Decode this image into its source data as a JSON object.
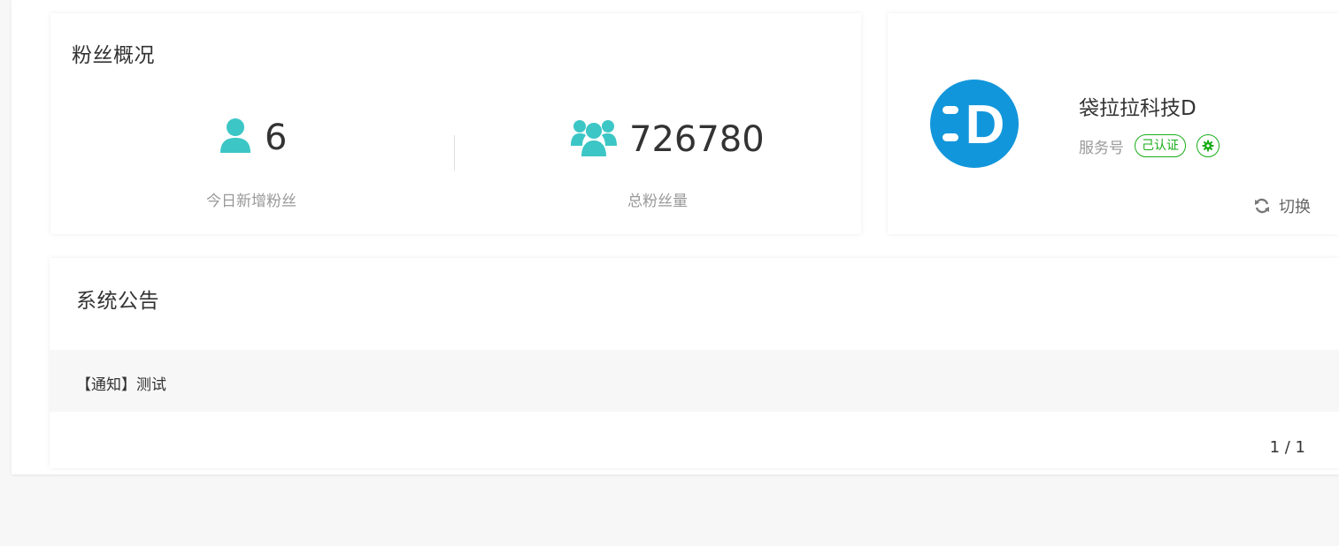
{
  "fans_overview": {
    "title": "粉丝概况",
    "today_new": {
      "value": "6",
      "label": "今日新增粉丝",
      "icon": "user-icon"
    },
    "total": {
      "value": "726780",
      "label": "总粉丝量",
      "icon": "users-group-icon"
    }
  },
  "account": {
    "name": "袋拉拉科技D",
    "type": "服务号",
    "verified_label": "己认证",
    "settings_icon": "gear-icon",
    "switch_label": "切换",
    "switch_icon": "refresh-icon",
    "logo_letter": "D"
  },
  "notices": {
    "title": "系统公告",
    "items": [
      {
        "text": "【通知】测试"
      }
    ],
    "pagination": "1 / 1"
  },
  "colors": {
    "accent_teal": "#3cc6c6",
    "verified_green": "#1aad19",
    "logo_blue": "#1296db"
  }
}
